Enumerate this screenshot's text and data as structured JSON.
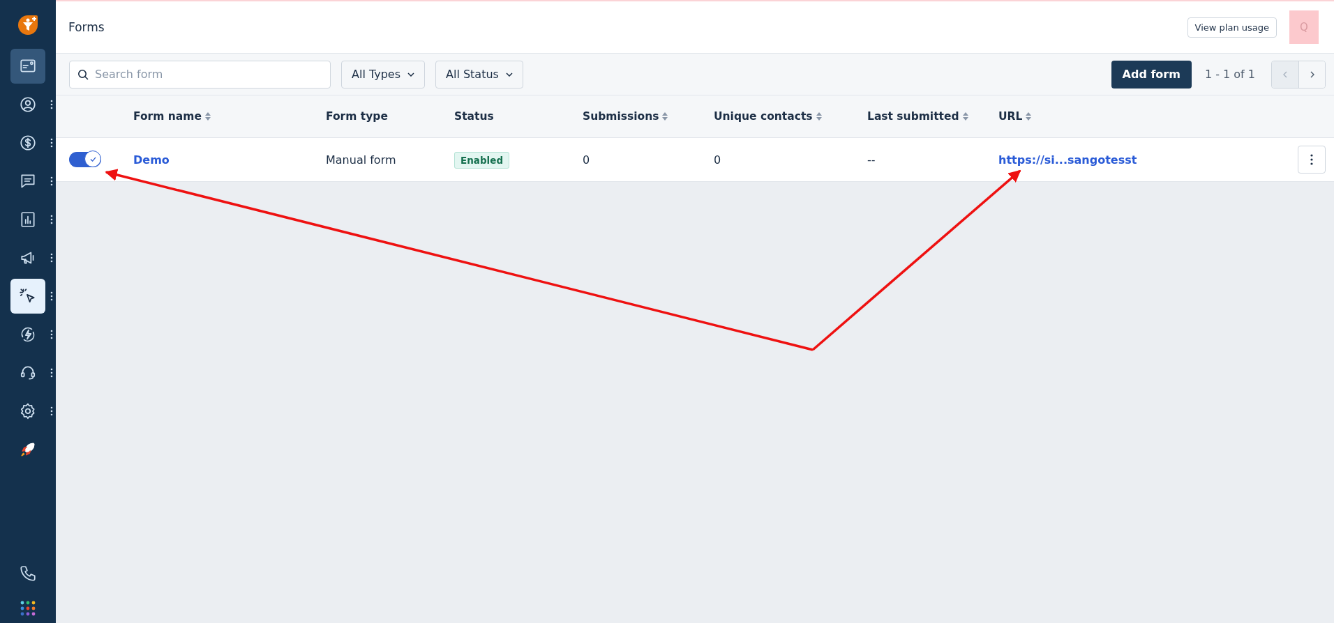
{
  "sidebar": {
    "items": [
      {
        "highlighted": true,
        "selected": false,
        "menu": false
      },
      {
        "highlighted": false,
        "selected": false,
        "menu": true
      },
      {
        "highlighted": false,
        "selected": false,
        "menu": true
      },
      {
        "highlighted": false,
        "selected": false,
        "menu": true
      },
      {
        "highlighted": false,
        "selected": false,
        "menu": true
      },
      {
        "highlighted": false,
        "selected": false,
        "menu": true
      },
      {
        "highlighted": false,
        "selected": true,
        "menu": true
      },
      {
        "highlighted": false,
        "selected": false,
        "menu": true
      },
      {
        "highlighted": false,
        "selected": false,
        "menu": true
      },
      {
        "highlighted": false,
        "selected": false,
        "menu": true
      },
      {
        "highlighted": false,
        "selected": false,
        "menu": false
      }
    ]
  },
  "header": {
    "title": "Forms",
    "plan_button": "View plan usage",
    "avatar": "Q"
  },
  "toolbar": {
    "search": {
      "placeholder": "Search form"
    },
    "filters": [
      "All Types",
      "All Status"
    ],
    "add_button": "Add form",
    "page_info": "1 - 1 of 1",
    "prev_disabled": true,
    "next_disabled": false
  },
  "table": {
    "columns": [
      {
        "label": "Form name",
        "sortable": true
      },
      {
        "label": "Form type",
        "sortable": false
      },
      {
        "label": "Status",
        "sortable": false
      },
      {
        "label": "Submissions",
        "sortable": true
      },
      {
        "label": "Unique contacts",
        "sortable": true
      },
      {
        "label": "Last submitted",
        "sortable": true
      },
      {
        "label": "URL",
        "sortable": true
      }
    ],
    "rows": [
      {
        "on": true,
        "name": "Demo",
        "type": "Manual form",
        "status": "Enabled",
        "submissions": "0",
        "contacts": "0",
        "last_submitted": "--",
        "url": "https://si...sangotesst"
      }
    ]
  }
}
